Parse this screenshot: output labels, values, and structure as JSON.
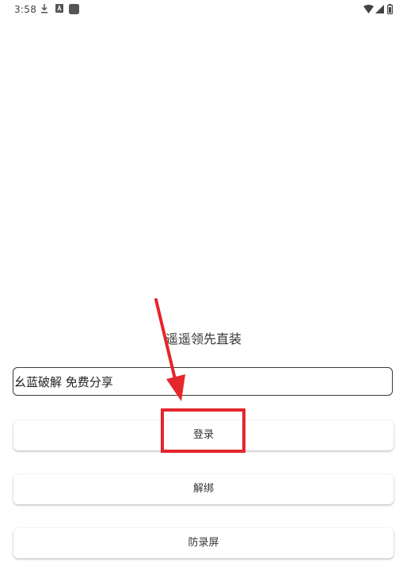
{
  "status_bar": {
    "time": "3:58",
    "left_icons": [
      "download-icon",
      "notification-a-icon",
      "app-square-icon"
    ],
    "right_icons": [
      "wifi-icon",
      "signal-icon",
      "battery-icon"
    ]
  },
  "app": {
    "title": "遥遥领先直装",
    "input": {
      "value": "幺蓝破解 免费分享",
      "placeholder": ""
    },
    "buttons": {
      "login": "登录",
      "unbind": "解绑",
      "anti_record": "防录屏"
    }
  },
  "annotation": {
    "color": "#e5262b",
    "target": "login-button"
  }
}
